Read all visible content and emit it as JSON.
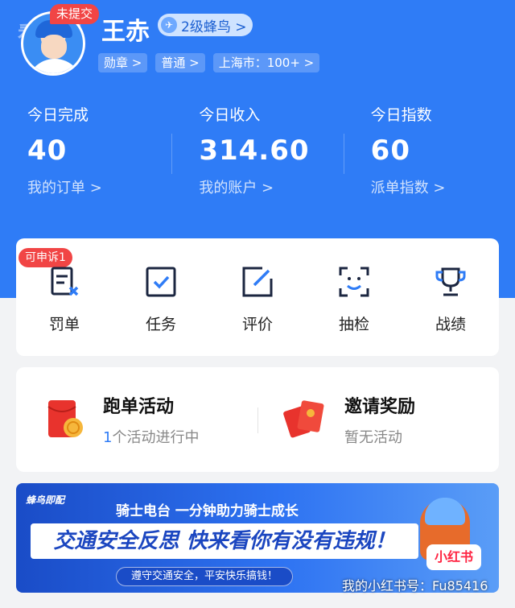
{
  "watermark": {
    "header_overlay": "看新闻",
    "xhs_chip": "小红书",
    "xhs_id": "我的小红书号：Fu85416"
  },
  "profile": {
    "name": "王赤",
    "unsubmitted_badge": "未提交",
    "level": "2级蜂鸟 >",
    "tags": [
      "勋章 >",
      "普通 >",
      "上海市：100+ >"
    ]
  },
  "stats": [
    {
      "label": "今日完成",
      "value": "40",
      "link": "我的订单 >"
    },
    {
      "label": "今日收入",
      "value": "314.60",
      "link": "我的账户 >"
    },
    {
      "label": "今日指数",
      "value": "60",
      "link": "派单指数 >"
    }
  ],
  "tools": {
    "appeal_badge": "可申诉1",
    "items": [
      {
        "label": "罚单",
        "icon": "ticket-icon"
      },
      {
        "label": "任务",
        "icon": "checkbox-icon"
      },
      {
        "label": "评价",
        "icon": "edit-icon"
      },
      {
        "label": "抽检",
        "icon": "face-scan-icon"
      },
      {
        "label": "战绩",
        "icon": "trophy-icon"
      }
    ]
  },
  "activities": [
    {
      "title": "跑单活动",
      "count": "1",
      "sub": "个活动进行中",
      "icon": "red-envelope-icon"
    },
    {
      "title": "邀请奖励",
      "sub": "暂无活动",
      "icon": "red-packets-icon"
    }
  ],
  "banner": {
    "brand": "蜂鸟即配",
    "subtitle": "骑士电台 一分钟助力骑士成长",
    "headline": "交通安全反思 快来看你有没有违规！",
    "pill": "遵守交通安全，平安快乐搞钱！"
  },
  "colors": {
    "primary": "#2f7cf6",
    "badge_red": "#f14545",
    "icon_blue": "#1b5fd1"
  }
}
